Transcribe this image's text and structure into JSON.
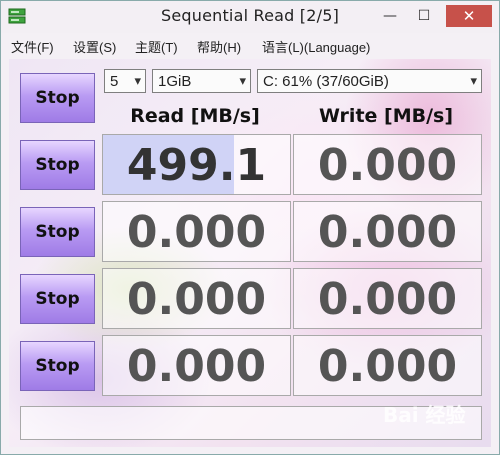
{
  "window": {
    "title": "Sequential Read [2/5]",
    "close_glyph": "✕",
    "minimize_glyph": "—",
    "maximize_glyph": "☐"
  },
  "menu": [
    "文件(F)",
    "设置(S)",
    "主题(T)",
    "帮助(H)",
    "语言(L)(Language)"
  ],
  "controls": {
    "count": "5",
    "size": "1GiB",
    "drive": "C: 61% (37/60GiB)",
    "dropdown_icon": "chevron-down-icon"
  },
  "buttons": {
    "stop_label": "Stop"
  },
  "columns": {
    "read_label": "Read [MB/s]",
    "write_label": "Write [MB/s]"
  },
  "results": [
    {
      "read": "499.1",
      "write": "0.000",
      "read_progress": 0.7
    },
    {
      "read": "0.000",
      "write": "0.000",
      "read_progress": 0
    },
    {
      "read": "0.000",
      "write": "0.000",
      "read_progress": 0
    },
    {
      "read": "0.000",
      "write": "0.000",
      "read_progress": 0
    }
  ],
  "watermark": "Bai 经验",
  "colors": {
    "stop_button": "#b99bf3",
    "close_button": "#c7514a",
    "progress_fill": "#c8cdf5"
  }
}
